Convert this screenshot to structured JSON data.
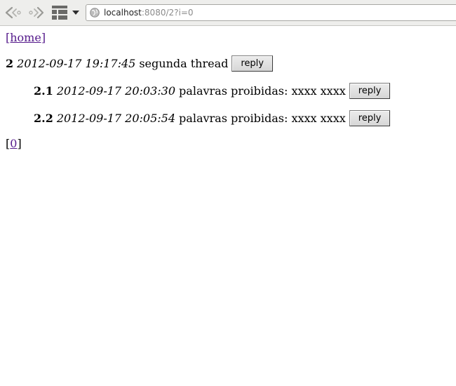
{
  "browser": {
    "url_host": "localhost",
    "url_rest": ":8080/2?i=0"
  },
  "page": {
    "home_link": "[home]",
    "thread": {
      "number": "2",
      "date": "2012-09-17 19:17:45",
      "text": "segunda thread",
      "reply_label": "reply"
    },
    "replies": [
      {
        "number": "2.1",
        "date": "2012-09-17 20:03:30",
        "text": "palavras proibidas: xxxx xxxx",
        "reply_label": "reply"
      },
      {
        "number": "2.2",
        "date": "2012-09-17 20:05:54",
        "text": "palavras proibidas: xxxx xxxx",
        "reply_label": "reply"
      }
    ],
    "pager": {
      "open": "[",
      "page": "0",
      "close": "]"
    }
  }
}
